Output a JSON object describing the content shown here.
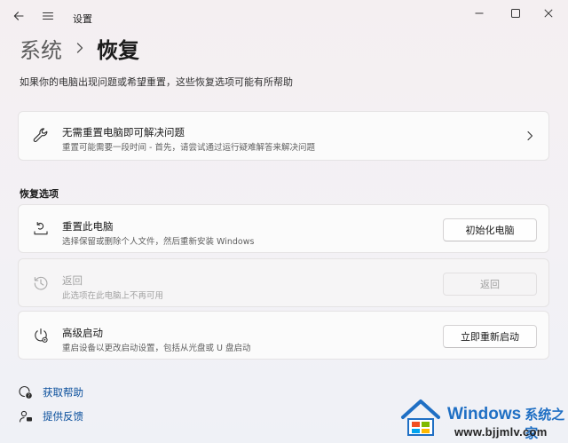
{
  "window": {
    "title": "设置"
  },
  "header": {
    "breadcrumb_parent": "系统",
    "breadcrumb_current": "恢复"
  },
  "description": "如果你的电脑出现问题或希望重置，这些恢复选项可能有所帮助",
  "fix_card": {
    "title": "无需重置电脑即可解决问题",
    "subtitle": "重置可能需要一段时间 - 首先，请尝试通过运行疑难解答来解决问题",
    "icon": "wrench-icon"
  },
  "section_title": "恢复选项",
  "options": {
    "reset": {
      "title": "重置此电脑",
      "subtitle": "选择保留或删除个人文件，然后重新安装 Windows",
      "button": "初始化电脑",
      "icon": "reset-pc-icon"
    },
    "goback": {
      "title": "返回",
      "subtitle": "此选项在此电脑上不再可用",
      "button": "返回",
      "icon": "history-icon",
      "disabled": true
    },
    "advanced": {
      "title": "高级启动",
      "subtitle": "重启设备以更改启动设置，包括从光盘或 U 盘启动",
      "button": "立即重新启动",
      "icon": "advanced-startup-icon"
    }
  },
  "footer": {
    "help": "获取帮助",
    "feedback": "提供反馈"
  },
  "watermark": {
    "brand": "Windows",
    "cn": "系统之家",
    "url": "www.bjjmlv.com"
  },
  "colors": {
    "link": "#0a4f9c",
    "watermark_blue": "#1f6fc4"
  }
}
